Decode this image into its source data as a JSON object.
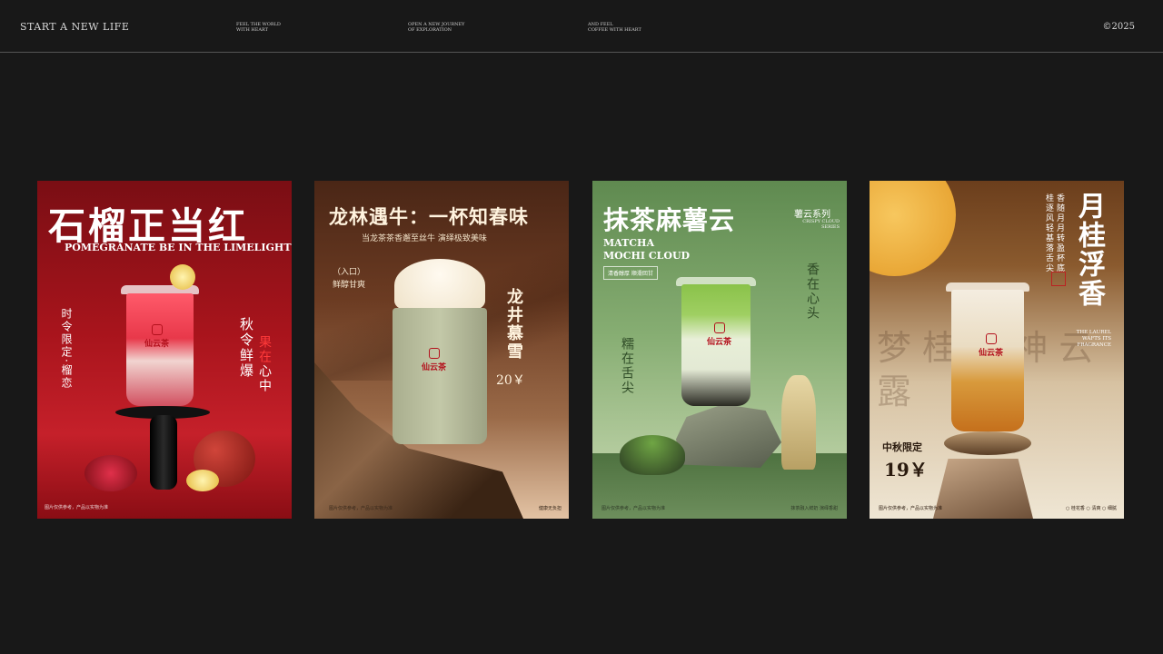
{
  "header": {
    "brand": "START A NEW LIFE",
    "nav": [
      {
        "line1": "FEEL THE WORLD",
        "line2": "WITH HEART"
      },
      {
        "line1": "OPEN A NEW JOURNEY",
        "line2": "OF EXPLORATION"
      },
      {
        "line1": "AND FEEL",
        "line2": "COFFEE WITH HEART"
      }
    ],
    "copyright": "©2025"
  },
  "posters": [
    {
      "title": "石榴正当红",
      "subtitle": "POMEGRANATE  BE IN THE LIMELIGHT",
      "left_vertical": "时令限定·榴恋",
      "right_vertical_1": "秋令鲜爆",
      "right_vertical_2_red": "果在",
      "right_vertical_2_rest": "心中",
      "brand_logo": "仙云茶",
      "footer": "图片仅供参考，产品以实物为准",
      "bg_color": "#a8141c"
    },
    {
      "title": "龙林遇牛：一杯知春味",
      "subtitle": "当龙茶茶香邂至丝牛   演绎极致美味",
      "left_line1": "（入口）",
      "left_line2": "鲜醇甘爽",
      "right_vertical": "龙井慕雪",
      "price": "20￥",
      "brand_logo": "仙云茶",
      "footer_left": "图片仅供参考，产品以实物为准",
      "footer_right": "健康无负担",
      "bg_color": "#6b3b22"
    },
    {
      "title": "抹茶麻薯云",
      "en_line1": "MATCHA",
      "en_line2": "MOCHI CLOUD",
      "tag": "清香醇厚   顺滑回甘",
      "series": "薯云系列",
      "series_en": "CRISPY CLOUD SERIES",
      "right_vertical": "香在心头",
      "left_vertical": "糯在舌尖",
      "brand_logo": "仙云茶",
      "footer_left": "图片仅供参考，产品以实物为准",
      "footer_right": "抹茶融入鲜奶  演绎香甜",
      "bg_color": "#86ad72"
    },
    {
      "title_vertical": "月桂浮香",
      "poem_1": "香随月月转盈杯底",
      "poem_2": "桂逐风轻基落舌尖",
      "en": "THE LAUREL WAFTS ITS FRAGRANCE",
      "limited": "中秋限定",
      "price": "19￥",
      "calligraphy": "梦 桂 香 神 云 露",
      "brand_logo": "仙云茶",
      "footer_left": "图片仅供参考，产品以实物为准",
      "footer_right": "○ 桂花香  ○ 清爽  ○ 细腻",
      "bg_color": "#8a5a2e"
    }
  ]
}
